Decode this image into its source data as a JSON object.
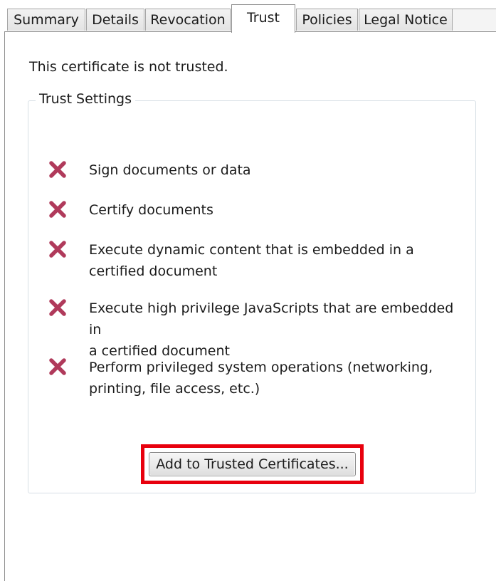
{
  "tabs": [
    {
      "label": "Summary",
      "active": false
    },
    {
      "label": "Details",
      "active": false
    },
    {
      "label": "Revocation",
      "active": false
    },
    {
      "label": "Trust",
      "active": true
    },
    {
      "label": "Policies",
      "active": false
    },
    {
      "label": "Legal Notice",
      "active": false
    }
  ],
  "trust": {
    "status_text": "This certificate is not trusted.",
    "group_title": "Trust Settings",
    "items": [
      {
        "icon": "x-icon",
        "lines": [
          "Sign documents or data"
        ]
      },
      {
        "icon": "x-icon",
        "lines": [
          "Certify documents"
        ]
      },
      {
        "icon": "x-icon",
        "lines": [
          "Execute dynamic content that is embedded in a",
          "certified document"
        ]
      },
      {
        "icon": "x-icon",
        "lines": [
          "Execute high privilege JavaScripts that are embedded in",
          "a certified document"
        ]
      },
      {
        "icon": "x-icon",
        "lines": [
          "Perform privileged system operations (networking,",
          "printing, file access, etc.)"
        ]
      }
    ],
    "add_button_label": "Add to Trusted Certificates..."
  },
  "colors": {
    "x_icon": "#b03a5b",
    "highlight": "#e8000d"
  }
}
